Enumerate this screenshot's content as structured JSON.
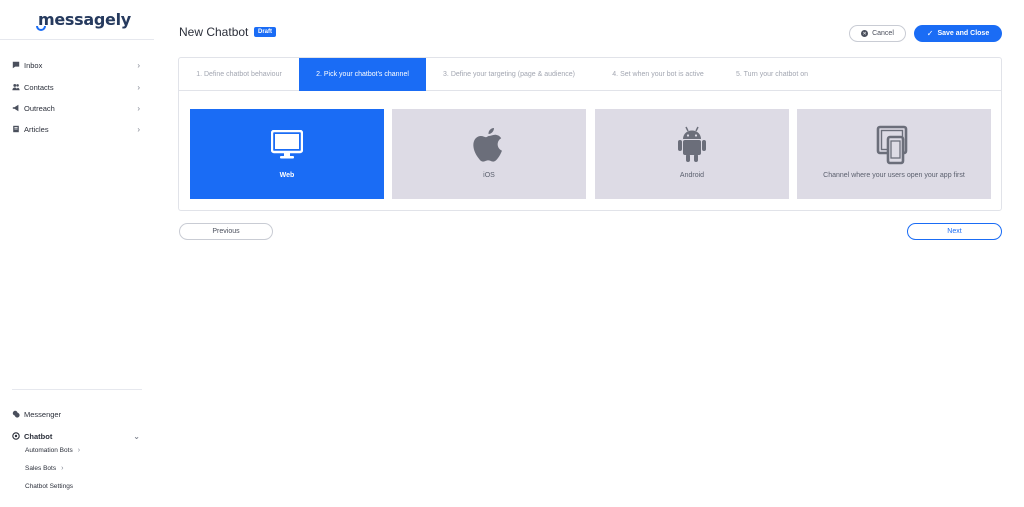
{
  "app": {
    "logo_text": "messagely"
  },
  "sidebar": {
    "top_items": [
      {
        "label": "Inbox",
        "icon": "chat-bubble-icon"
      },
      {
        "label": "Contacts",
        "icon": "people-icon"
      },
      {
        "label": "Outreach",
        "icon": "megaphone-icon"
      },
      {
        "label": "Articles",
        "icon": "book-icon"
      }
    ],
    "messenger": {
      "label": "Messenger",
      "icon": "messenger-icon"
    },
    "chatbot": {
      "label": "Chatbot",
      "icon": "chatbot-icon"
    },
    "chatbot_sub": [
      {
        "label": "Automation Bots"
      },
      {
        "label": "Sales Bots"
      },
      {
        "label": "Chatbot Settings"
      }
    ]
  },
  "header": {
    "title": "New Chatbot",
    "badge": "Draft",
    "cancel_label": "Cancel",
    "save_label": "Save and Close"
  },
  "steps": [
    {
      "label": "1. Define chatbot behaviour",
      "active": false
    },
    {
      "label": "2. Pick your chatbot's channel",
      "active": true
    },
    {
      "label": "3. Define your targeting (page & audience)",
      "active": false
    },
    {
      "label": "4. Set when your bot is active",
      "active": false
    },
    {
      "label": "5. Turn your chatbot on",
      "active": false
    }
  ],
  "channels": [
    {
      "label": "Web",
      "icon": "monitor-icon",
      "selected": true
    },
    {
      "label": "iOS",
      "icon": "apple-icon",
      "selected": false
    },
    {
      "label": "Android",
      "icon": "android-icon",
      "selected": false
    },
    {
      "label": "Channel where your users open your app first",
      "icon": "devices-icon",
      "selected": false
    }
  ],
  "nav": {
    "previous_label": "Previous",
    "next_label": "Next"
  },
  "colors": {
    "accent": "#1a6cf5",
    "card_bg": "#dddbe5",
    "icon_gray": "#6b6e7a"
  }
}
